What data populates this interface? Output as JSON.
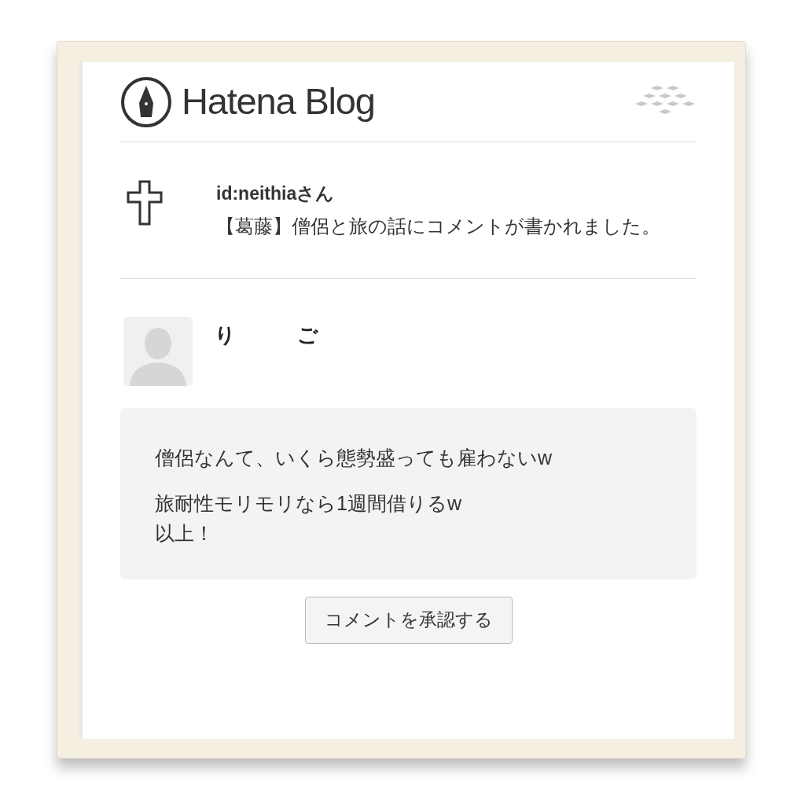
{
  "header": {
    "logo_text": "Hatena Blog"
  },
  "notification": {
    "user": "id:neithiaさん",
    "message": "【葛藤】僧侶と旅の話にコメントが書かれました。"
  },
  "comment": {
    "author": "り　　　ご",
    "lines": [
      "僧侶なんて、いくら態勢盛っても雇わないw",
      "旅耐性モリモリなら1週間借りるw\n以上！"
    ]
  },
  "approve_button": "コメントを承認する"
}
